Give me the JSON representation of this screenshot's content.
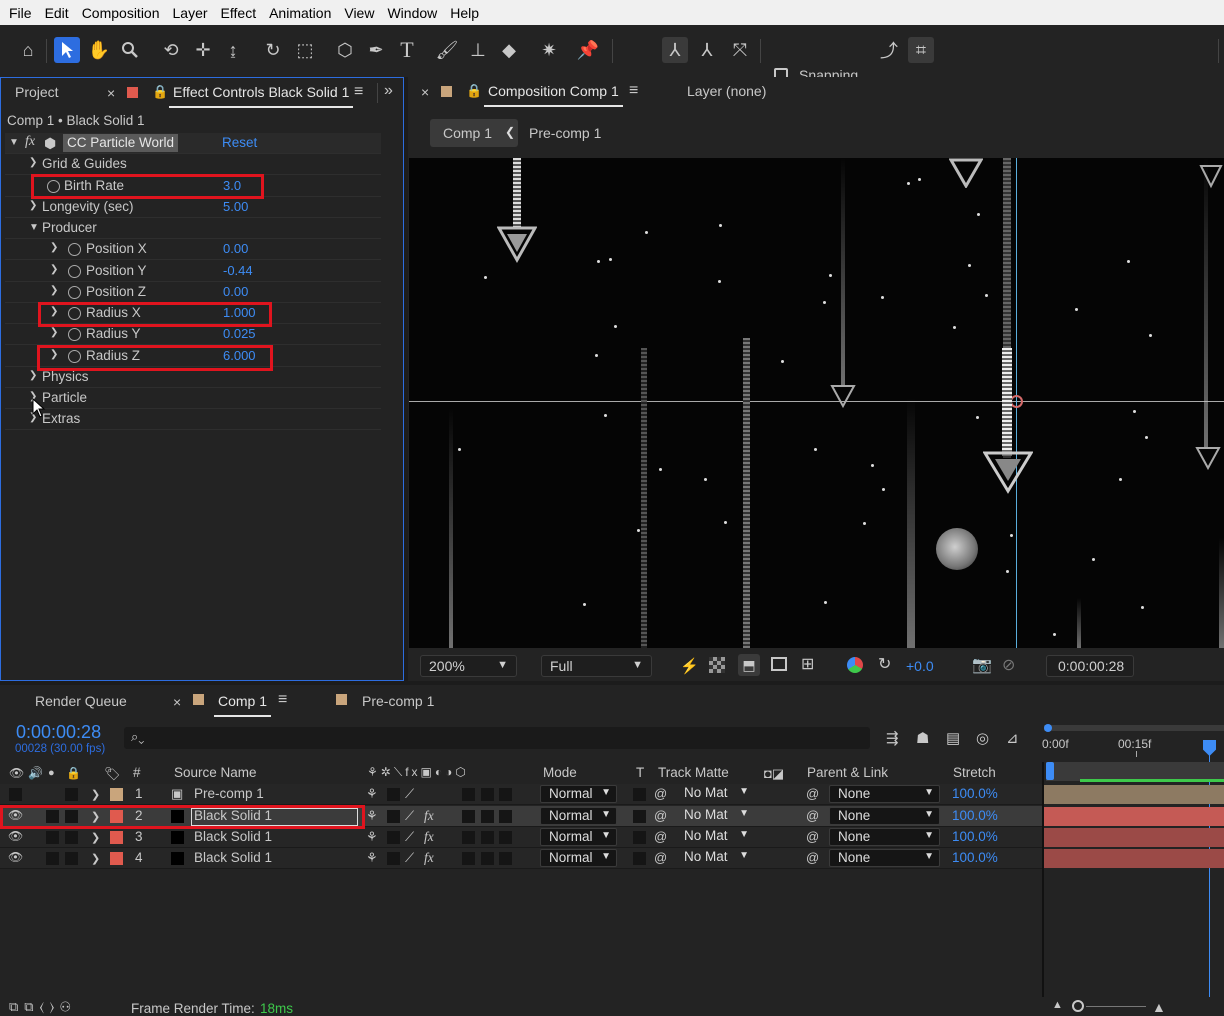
{
  "menu": [
    "File",
    "Edit",
    "Composition",
    "Layer",
    "Effect",
    "Animation",
    "View",
    "Window",
    "Help"
  ],
  "toolbar": {
    "snapping_label": "Snapping"
  },
  "project_panel": {
    "tab_project": "Project",
    "tab_effect_controls": "Effect Controls Black Solid 1",
    "breadcrumb": "Comp 1 • Black Solid 1",
    "effect_name": "CC Particle World",
    "reset_label": "Reset",
    "properties": [
      {
        "label": "Grid & Guides",
        "value": ""
      },
      {
        "label": "Birth Rate",
        "value": "3.0"
      },
      {
        "label": "Longevity (sec)",
        "value": "5.00"
      },
      {
        "label": "Producer",
        "value": ""
      },
      {
        "label": "Position X",
        "value": "0.00"
      },
      {
        "label": "Position Y",
        "value": "-0.44"
      },
      {
        "label": "Position Z",
        "value": "0.00"
      },
      {
        "label": "Radius X",
        "value": "1.000"
      },
      {
        "label": "Radius Y",
        "value": "0.025"
      },
      {
        "label": "Radius Z",
        "value": "6.000"
      },
      {
        "label": "Physics",
        "value": ""
      },
      {
        "label": "Particle",
        "value": ""
      },
      {
        "label": "Extras",
        "value": ""
      }
    ]
  },
  "comp_panel": {
    "tab_composition": "Composition Comp 1",
    "tab_layer": "Layer (none)",
    "crumb_comp1": "Comp 1",
    "crumb_precomp": "Pre-comp 1",
    "zoom": "200%",
    "resolution": "Full",
    "exposure": "+0.0",
    "timecode": "0:00:00:28"
  },
  "timeline": {
    "tab_render_queue": "Render Queue",
    "tab_comp1": "Comp 1",
    "tab_precomp1": "Pre-comp 1",
    "current_time": "0:00:00:28",
    "frame_info": "00028 (30.00 fps)",
    "search_placeholder": "",
    "ruler_labels": [
      "0:00f",
      "00:15f"
    ],
    "headers": {
      "hash": "#",
      "source_name": "Source Name",
      "mode": "Mode",
      "t": "T",
      "track_matte": "Track Matte",
      "parent_link": "Parent & Link",
      "stretch": "Stretch"
    },
    "layers": [
      {
        "num": "1",
        "name": "Pre-comp 1",
        "mode": "Normal",
        "matte": "No Mat",
        "parent": "None",
        "stretch": "100.0%",
        "color": "#c9a57c"
      },
      {
        "num": "2",
        "name": "Black Solid 1",
        "mode": "Normal",
        "matte": "No Mat",
        "parent": "None",
        "stretch": "100.0%",
        "color": "#e05a4e"
      },
      {
        "num": "3",
        "name": "Black Solid 1",
        "mode": "Normal",
        "matte": "No Mat",
        "parent": "None",
        "stretch": "100.0%",
        "color": "#e05a4e"
      },
      {
        "num": "4",
        "name": "Black Solid 1",
        "mode": "Normal",
        "matte": "No Mat",
        "parent": "None",
        "stretch": "100.0%",
        "color": "#e05a4e"
      }
    ],
    "status_label": "Frame Render Time:",
    "status_value": "18ms"
  },
  "colors": {
    "accent": "#2d6de0",
    "value_blue": "#3d8cf5",
    "highlight_red": "#e0141e",
    "status_green": "#3ec94b"
  }
}
